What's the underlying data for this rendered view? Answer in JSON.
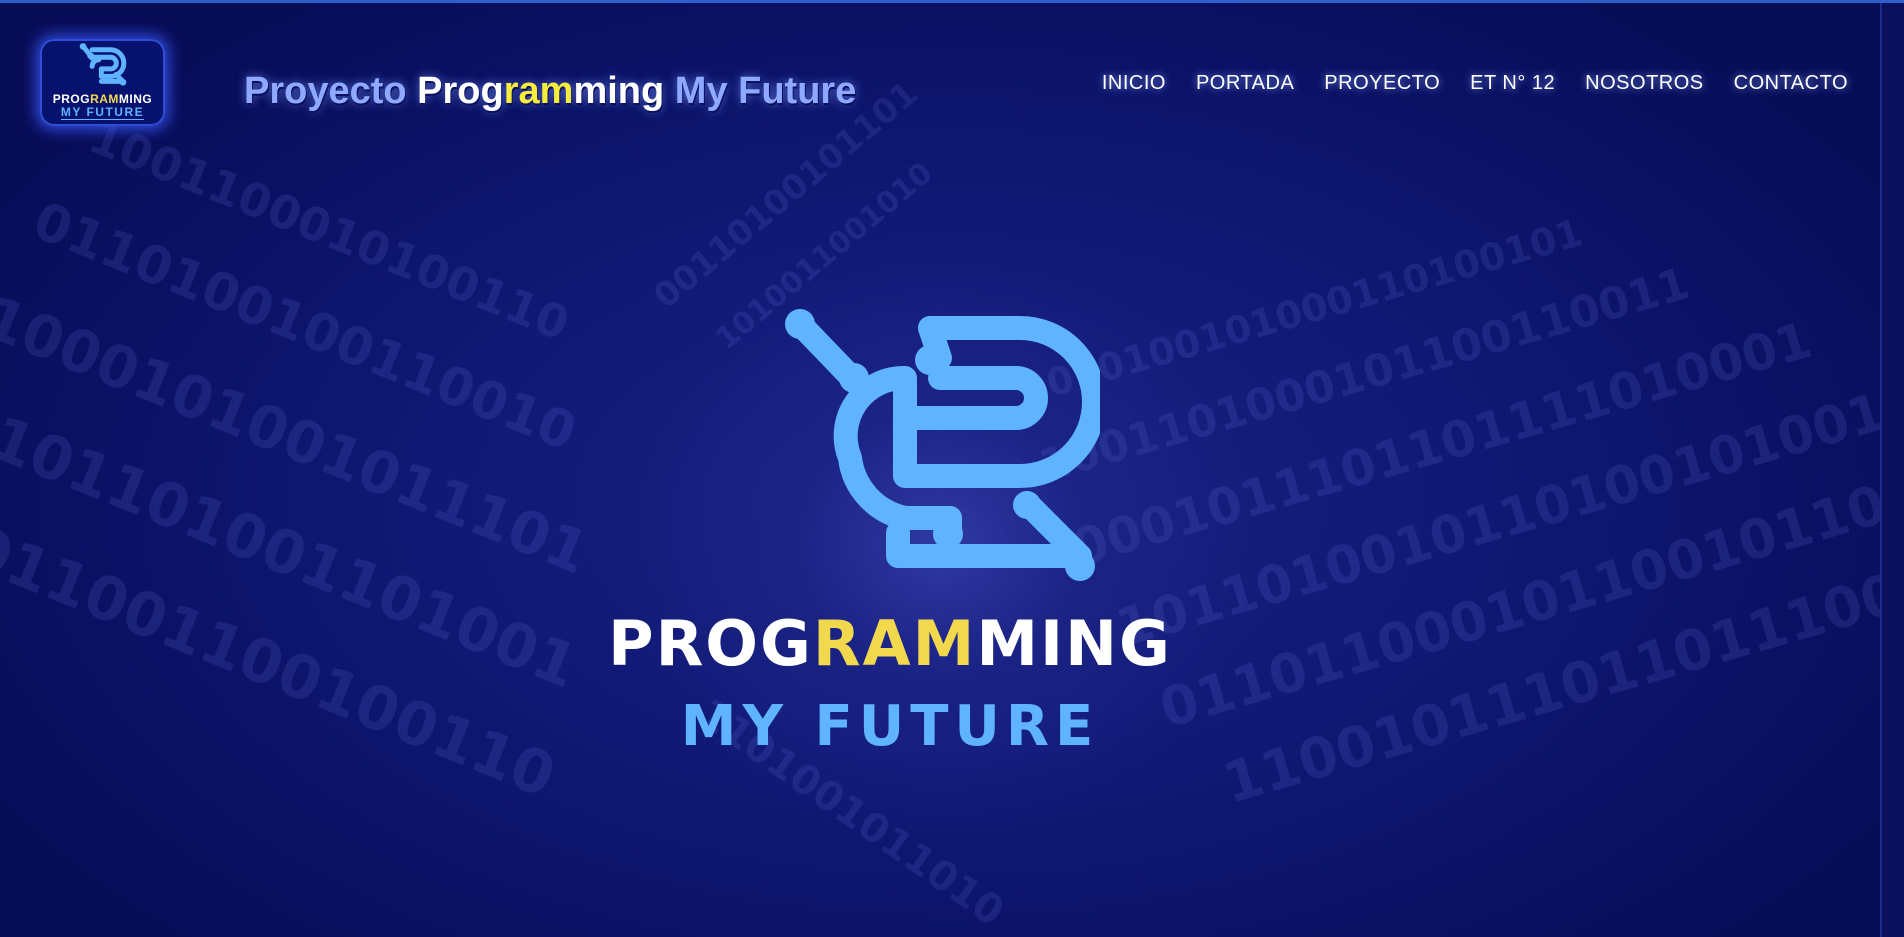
{
  "header": {
    "badge": {
      "line1_a": "PROG",
      "line1_b": "RAM",
      "line1_c": "MING",
      "line2": "MY FUTURE"
    },
    "title": {
      "part1": "Proyecto ",
      "part2": "Prog",
      "part3": "ram",
      "part4": "ming",
      "part5": " My Future"
    }
  },
  "nav": {
    "items": [
      {
        "label": "INICIO"
      },
      {
        "label": "PORTADA"
      },
      {
        "label": "PROYECTO"
      },
      {
        "label": "ET N° 12"
      },
      {
        "label": "NOSOTROS"
      },
      {
        "label": "CONTACTO"
      }
    ]
  },
  "hero": {
    "brand_a": "PROG",
    "brand_b": "RAM",
    "brand_c": "MING",
    "brand_line2": "MY FUTURE",
    "icon": "circuit-p-logo-icon"
  },
  "colors": {
    "background": "#0a0f5e",
    "accent_blue": "#5fb3ff",
    "accent_yellow": "#f2d84d",
    "title_blue": "#8ea9ff"
  }
}
